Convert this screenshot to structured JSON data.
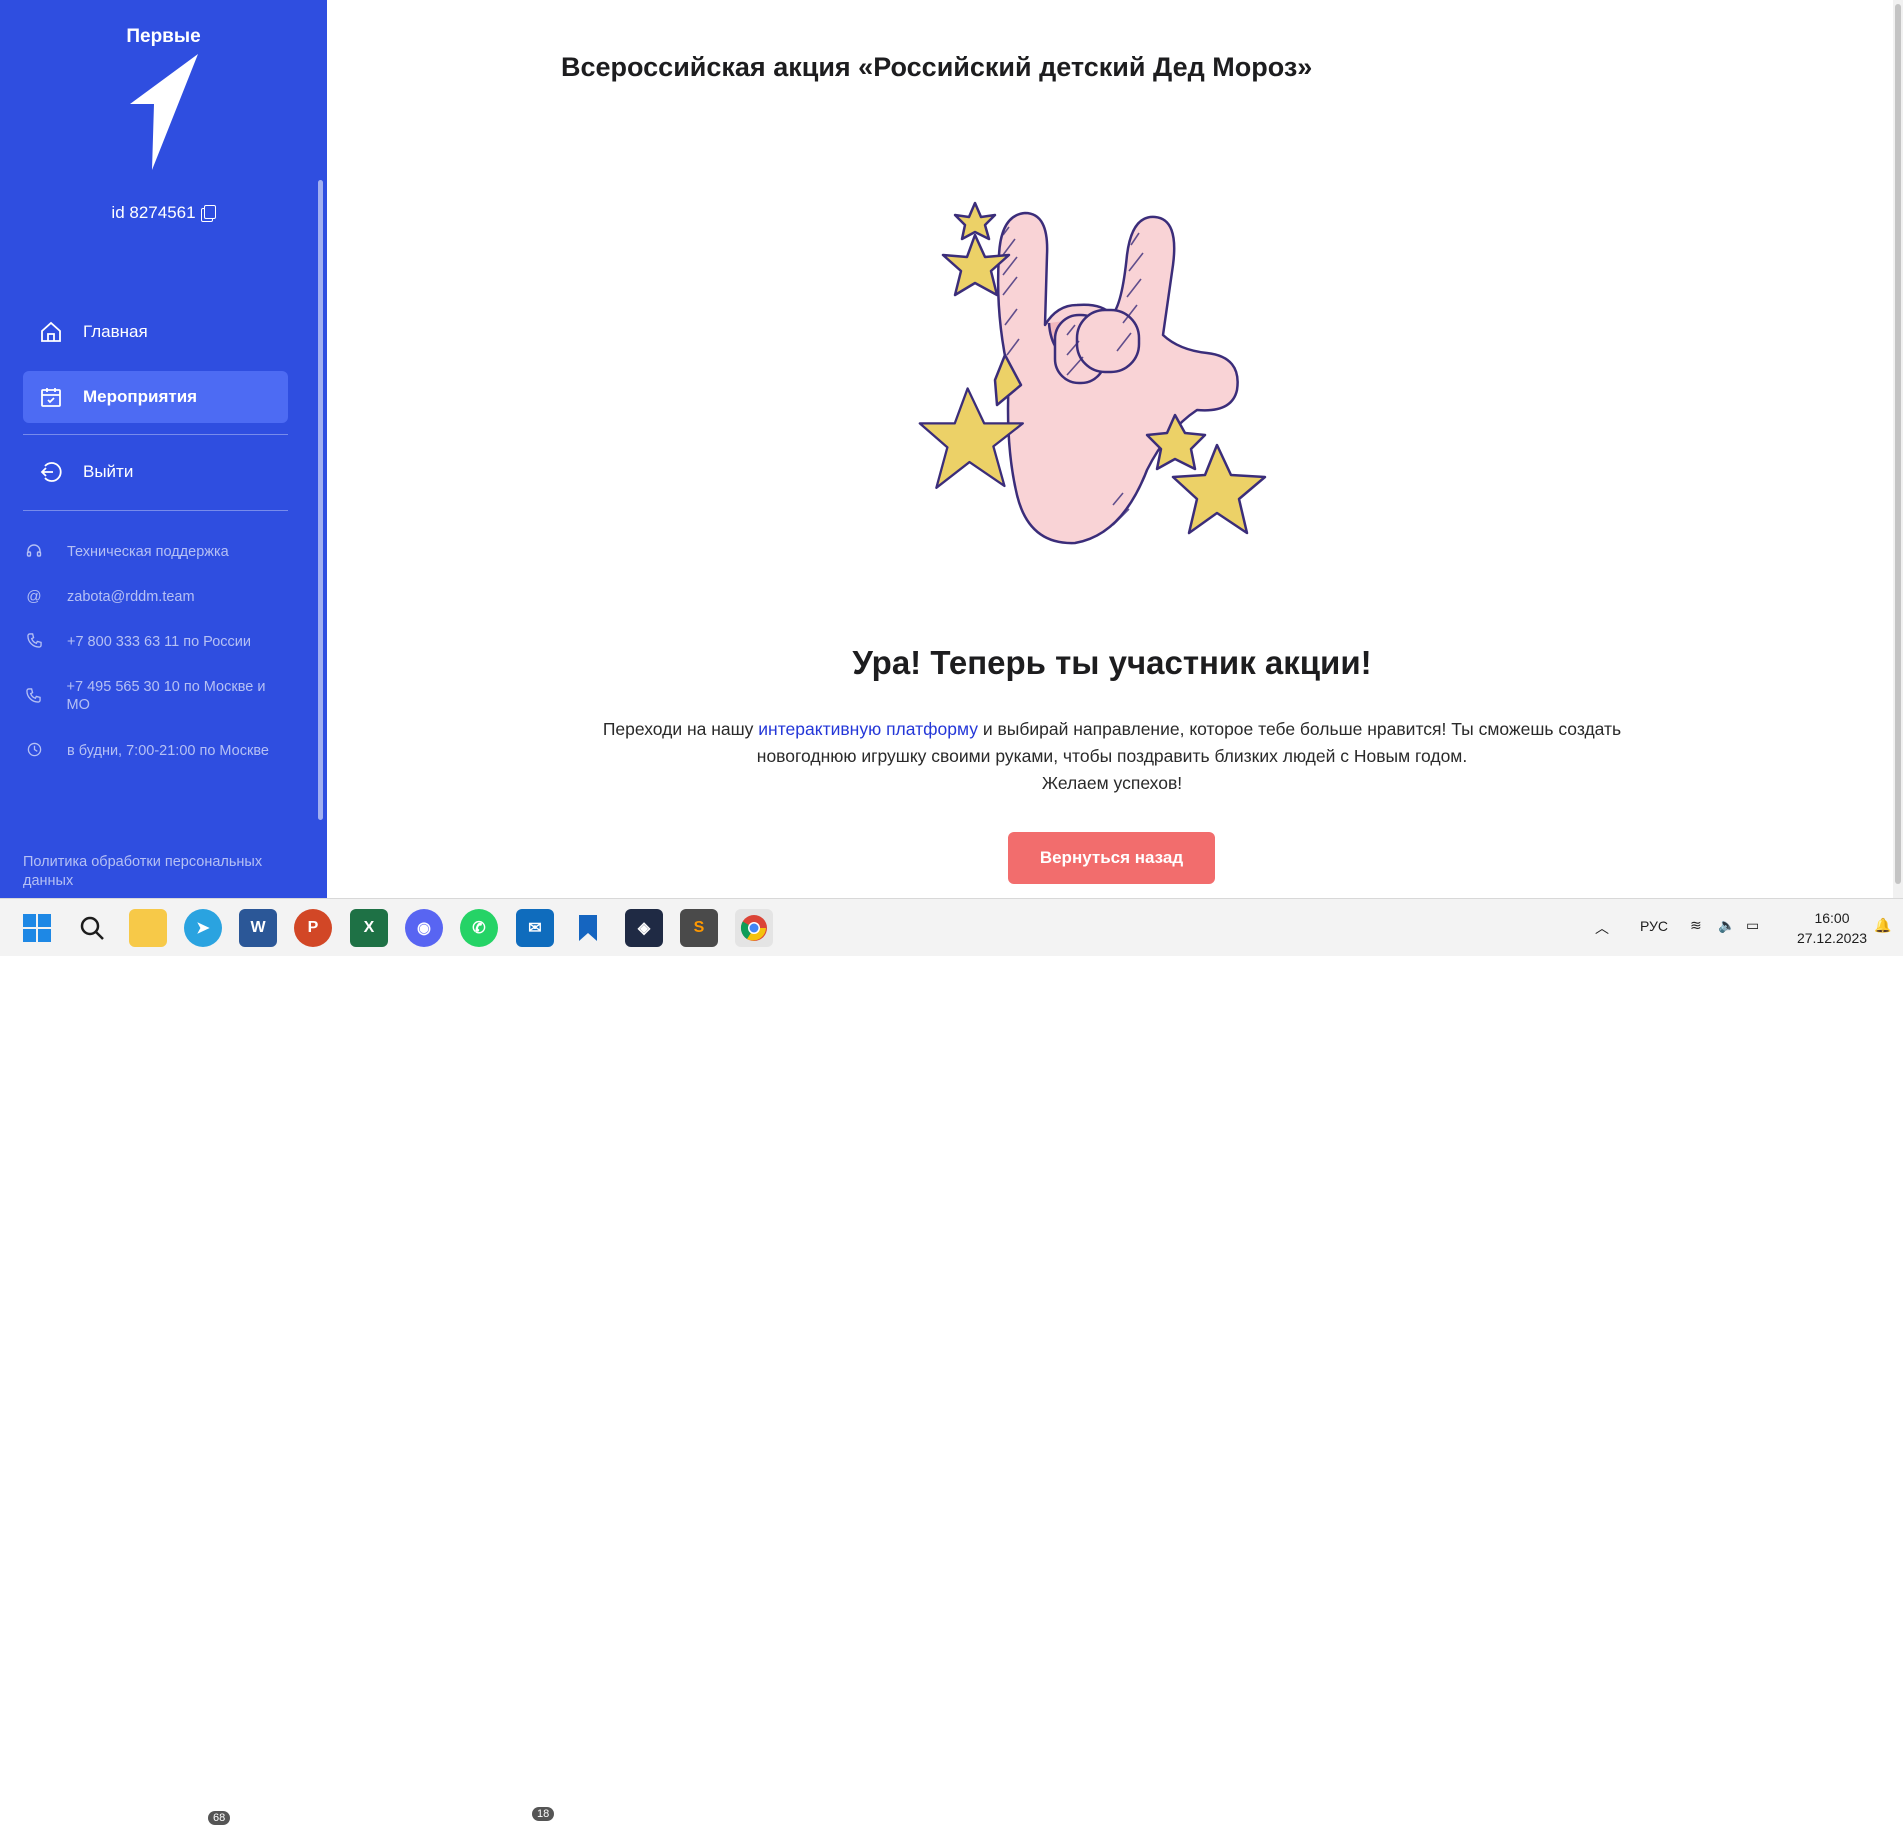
{
  "sidebar": {
    "brand": "Первые",
    "user_id": "id 8274561",
    "nav": [
      {
        "label": "Главная",
        "icon": "home-icon"
      },
      {
        "label": "Мероприятия",
        "icon": "calendar-icon"
      },
      {
        "label": "Выйти",
        "icon": "logout-icon"
      }
    ],
    "info": [
      {
        "label": "Техническая поддержка",
        "icon": "headset-icon"
      },
      {
        "label": "zabota@rddm.team",
        "icon": "at-icon"
      },
      {
        "label": "+7 800 333 63 11 по России",
        "icon": "phone-icon"
      },
      {
        "label": "+7 495 565 30 10 по Москве и МО",
        "icon": "phone-icon"
      },
      {
        "label": "в будни, 7:00-21:00 по Москве",
        "icon": "clock-icon"
      }
    ],
    "policy": "Политика обработки персональных данных"
  },
  "main": {
    "title": "Всероссийская акция «Российский детский Дед Мороз»",
    "headline": "Ура! Теперь ты участник акции!",
    "body_before_link": "Переходи на нашу ",
    "link_text": "интерактивную платформу",
    "body_after_link": " и выбирай направление, которое тебе больше нравится! Ты сможешь создать новогоднюю игрушку своими руками, чтобы поздравить близких людей с Новым годом.",
    "wish": "Желаем успехов!",
    "back_button": "Вернуться назад"
  },
  "taskbar": {
    "apps": [
      "start-icon",
      "search-icon",
      "file-explorer-icon",
      "telegram-icon",
      "word-icon",
      "powerpoint-icon",
      "excel-icon",
      "discord-icon",
      "whatsapp-icon",
      "mail-icon",
      "bookmark-icon",
      "davinci-icon",
      "sublime-icon",
      "chrome-icon"
    ],
    "telegram_badge": "68",
    "mail_badge": "18",
    "language": "РУС",
    "time": "16:00",
    "date": "27.12.2023"
  },
  "colors": {
    "sidebar": "#2f4ee0",
    "active_nav": "#4d6bf3",
    "button": "#f26d6d",
    "link": "#2437d8"
  }
}
